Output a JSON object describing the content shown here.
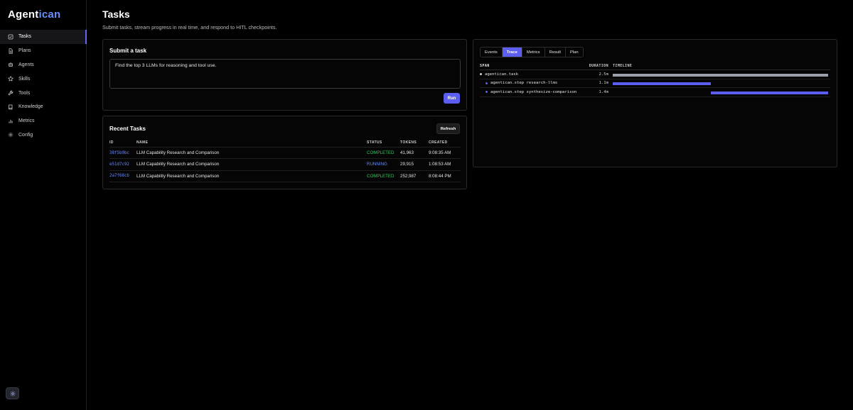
{
  "brand": {
    "part1": "Agent",
    "part2": "ican"
  },
  "sidebar": {
    "items": [
      {
        "label": "Tasks",
        "icon": "checkbox-icon",
        "active": true
      },
      {
        "label": "Plans",
        "icon": "document-icon"
      },
      {
        "label": "Agents",
        "icon": "robot-icon"
      },
      {
        "label": "Skills",
        "icon": "star-icon"
      },
      {
        "label": "Tools",
        "icon": "wrench-icon"
      },
      {
        "label": "Knowledge",
        "icon": "book-icon"
      },
      {
        "label": "Metrics",
        "icon": "bar-chart-icon"
      },
      {
        "label": "Config",
        "icon": "gear-icon"
      }
    ],
    "theme_toggle_icon": "sun-icon"
  },
  "page": {
    "title": "Tasks",
    "subtitle": "Submit tasks, stream progress in real time, and respond to HITL checkpoints."
  },
  "submit": {
    "title": "Submit a task",
    "input_value": "Find the top 3 LLMs for reasoning and tool use.",
    "run_label": "Run"
  },
  "recent": {
    "title": "Recent Tasks",
    "refresh_label": "Refresh",
    "columns": {
      "id": "ID",
      "name": "NAME",
      "status": "STATUS",
      "tokens": "TOKENS",
      "created": "CREATED"
    },
    "rows": [
      {
        "id": "38f5b9bc",
        "name": "LLM Capability Research and Comparison",
        "status": "COMPLETED",
        "tokens": "41,963",
        "created": "9:08:35 AM"
      },
      {
        "id": "e51d7c92",
        "name": "LLM Capability Research and Comparison",
        "status": "RUNNING",
        "tokens": "29,915",
        "created": "1:08:53 AM"
      },
      {
        "id": "2a7f68cb",
        "name": "LLM Capability Research and Comparison",
        "status": "COMPLETED",
        "tokens": "252,987",
        "created": "8:08:44 PM"
      }
    ]
  },
  "trace": {
    "tabs": [
      "Events",
      "Trace",
      "Metrics",
      "Result",
      "Plan"
    ],
    "active_tab": "Trace",
    "columns": {
      "span": "SPAN",
      "duration": "DURATION",
      "timeline": "TIMELINE"
    },
    "spans": [
      {
        "name": "agentican.task",
        "duration": "2.5m",
        "depth": 0,
        "start_fraction": 0.0,
        "width_fraction": 1.0,
        "color": "#9aa0aa"
      },
      {
        "name": "agentican.step research-llms",
        "duration": "1.1m",
        "depth": 1,
        "start_fraction": 0.0,
        "width_fraction": 0.455,
        "color": "#5b5ef0"
      },
      {
        "name": "agentican.step synthesize-comparison",
        "duration": "1.4m",
        "depth": 1,
        "start_fraction": 0.455,
        "width_fraction": 0.545,
        "color": "#5b5ef0"
      }
    ]
  },
  "colors": {
    "accent": "#5b5ef0",
    "link": "#6a8dff",
    "completed": "#2ecc59",
    "running": "#6a8dff"
  }
}
